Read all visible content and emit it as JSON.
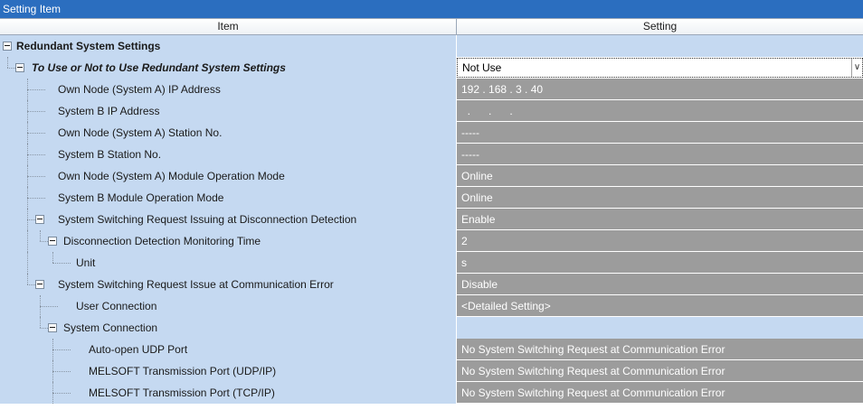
{
  "window": {
    "title": "Setting Item"
  },
  "columns": {
    "item": "Item",
    "setting": "Setting"
  },
  "rows": [
    {
      "label": "Redundant System Settings",
      "value": ""
    },
    {
      "label": "To Use or Not to Use Redundant System Settings",
      "value": "Not Use"
    },
    {
      "label": "Own Node (System A) IP Address",
      "value": "192 . 168 .  3 . 40"
    },
    {
      "label": "System B IP Address",
      "value": "  .      .      .   "
    },
    {
      "label": "Own Node (System A) Station No.",
      "value": "-----"
    },
    {
      "label": "System B Station No.",
      "value": "-----"
    },
    {
      "label": "Own Node (System A) Module Operation Mode",
      "value": "Online"
    },
    {
      "label": "System B Module Operation Mode",
      "value": "Online"
    },
    {
      "label": "System Switching Request Issuing at Disconnection Detection",
      "value": "Enable"
    },
    {
      "label": "Disconnection Detection Monitoring Time",
      "value": "2"
    },
    {
      "label": "Unit",
      "value": "s"
    },
    {
      "label": "System Switching Request Issue at Communication Error",
      "value": "Disable"
    },
    {
      "label": "User Connection",
      "value": "<Detailed Setting>"
    },
    {
      "label": "System Connection",
      "value": ""
    },
    {
      "label": "Auto-open UDP Port",
      "value": "No System Switching Request at Communication Error"
    },
    {
      "label": "MELSOFT Transmission Port (UDP/IP)",
      "value": "No System Switching Request at Communication Error"
    },
    {
      "label": "MELSOFT Transmission Port (TCP/IP)",
      "value": "No System Switching Request at Communication Error"
    }
  ],
  "dropdown": {
    "arrow_icon": "chevron-down-icon"
  }
}
